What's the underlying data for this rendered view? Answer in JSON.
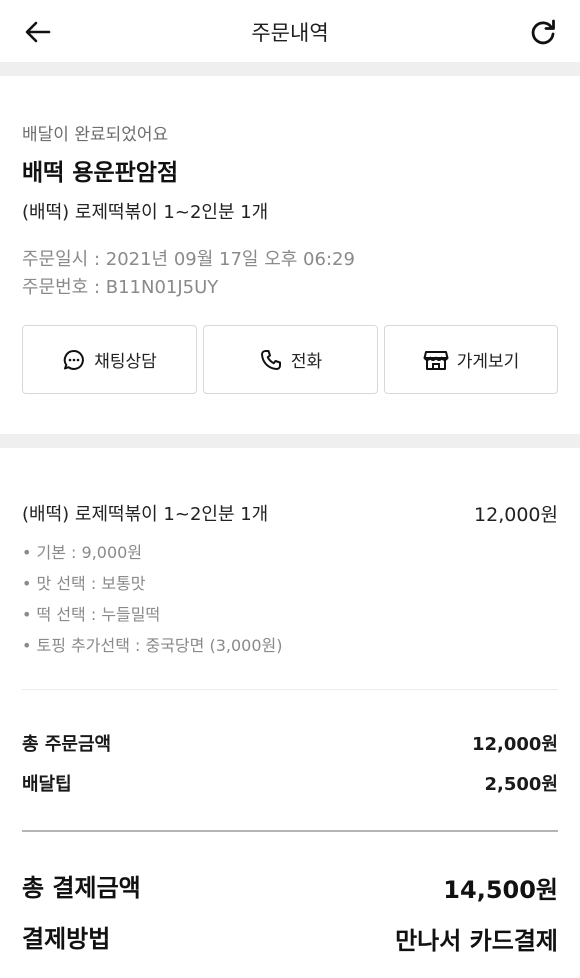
{
  "header": {
    "title": "주문내역",
    "back_icon": "arrow-left-icon",
    "refresh_icon": "refresh-icon"
  },
  "summary": {
    "status": "배달이 완료되었어요",
    "store_name": "배떡 용운판암점",
    "menu_summary": "(배떡) 로제떡볶이 1~2인분 1개",
    "order_date": "주문일시 : 2021년 09월 17일 오후 06:29",
    "order_number": "주문번호 : B11N01J5UY",
    "buttons": [
      {
        "label": "채팅상담",
        "icon": "chat-bubble-icon"
      },
      {
        "label": "전화",
        "icon": "phone-icon"
      },
      {
        "label": "가게보기",
        "icon": "store-icon"
      }
    ]
  },
  "order_detail": {
    "item_name": "(배떡) 로제떡볶이 1~2인분 1개",
    "item_price": "12,000원",
    "options": [
      "• 기본 : 9,000원",
      "• 맛 선택 : 보통맛",
      "• 떡 선택 : 누들밀떡",
      "• 토핑 추가선택 : 중국당면 (3,000원)"
    ]
  },
  "totals": {
    "order_total_label": "총 주문금액",
    "order_total_value": "12,000원",
    "delivery_tip_label": "배달팁",
    "delivery_tip_value": "2,500원",
    "payment_total_label": "총 결제금액",
    "payment_total_value": "14,500원",
    "payment_method_label": "결제방법",
    "payment_method_value": "만나서 카드결제"
  },
  "colors": {
    "band": "#efefef",
    "text": "#1f1f1f",
    "muted": "#8a8a8a",
    "border": "#d8d8d8"
  }
}
